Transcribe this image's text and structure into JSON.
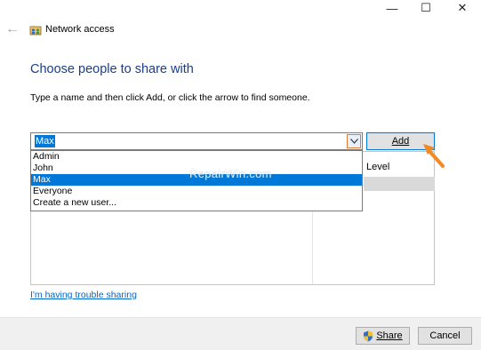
{
  "window": {
    "minimize_glyph": "—",
    "maximize_glyph": "☐",
    "close_glyph": "✕"
  },
  "nav": {
    "back_glyph": "←",
    "back_icon": "back-arrow-icon"
  },
  "header": {
    "app_icon": "network-share-icon",
    "title": "Network access"
  },
  "main": {
    "heading": "Choose people to share with",
    "instruction": "Type a name and then click Add, or click the arrow to find someone."
  },
  "name_input": {
    "value": "Max",
    "dropdown_icon": "chevron-down-icon"
  },
  "add_button": {
    "label": "Add"
  },
  "dropdown": {
    "options": [
      "Admin",
      "John",
      "Max",
      "Everyone",
      "Create a new user..."
    ],
    "selected_index": 2
  },
  "table": {
    "permission_level_header": "Level"
  },
  "watermark": {
    "text": "RepairWin.com"
  },
  "trouble_link": {
    "text": "I'm having trouble sharing"
  },
  "footer": {
    "share_label": "Share",
    "share_icon": "uac-shield-icon",
    "cancel_label": "Cancel"
  },
  "colors": {
    "heading": "#1a3e8a",
    "selection": "#0078d7",
    "link": "#0066cc",
    "highlight_arrow": "#f08a24"
  }
}
